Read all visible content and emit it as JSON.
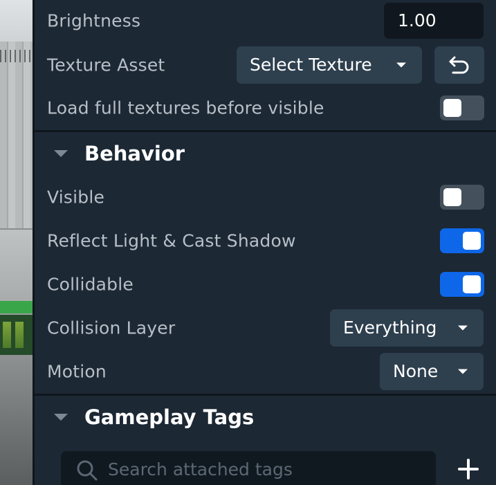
{
  "material": {
    "brightness_label": "Brightness",
    "brightness_value": "1.00",
    "texture_asset_label": "Texture Asset",
    "texture_dropdown_value": "Select Texture",
    "load_full_textures_label": "Load full textures before visible",
    "load_full_textures_on": false
  },
  "behavior": {
    "title": "Behavior",
    "visible_label": "Visible",
    "visible_on": false,
    "reflect_light_label": "Reflect Light & Cast Shadow",
    "reflect_light_on": true,
    "collidable_label": "Collidable",
    "collidable_on": true,
    "collision_layer_label": "Collision Layer",
    "collision_layer_value": "Everything",
    "motion_label": "Motion",
    "motion_value": "None"
  },
  "gameplay_tags": {
    "title": "Gameplay Tags",
    "search_placeholder": "Search attached tags"
  },
  "icons": {
    "reset": "undo-arrow-icon",
    "search": "search-icon",
    "add": "plus-icon",
    "section_toggle": "caret-down-icon"
  },
  "colors": {
    "panel_bg": "#1c2834",
    "field_bg": "#2e3f4e",
    "toggle_on": "#0d67e8",
    "toggle_off": "#44515d"
  }
}
